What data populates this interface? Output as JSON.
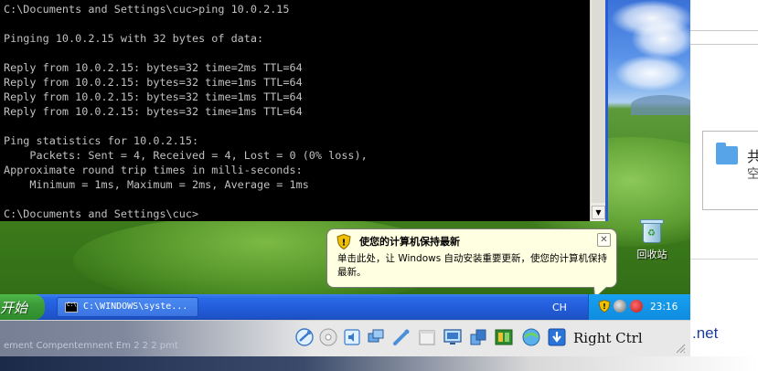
{
  "console": {
    "lines": [
      "C:\\Documents and Settings\\cuc>ping 10.0.2.15",
      "",
      "Pinging 10.0.2.15 with 32 bytes of data:",
      "",
      "Reply from 10.0.2.15: bytes=32 time=2ms TTL=64",
      "Reply from 10.0.2.15: bytes=32 time=1ms TTL=64",
      "Reply from 10.0.2.15: bytes=32 time=1ms TTL=64",
      "Reply from 10.0.2.15: bytes=32 time=1ms TTL=64",
      "",
      "Ping statistics for 10.0.2.15:",
      "    Packets: Sent = 4, Received = 4, Lost = 0 (0% loss),",
      "Approximate round trip times in milli-seconds:",
      "    Minimum = 1ms, Maximum = 2ms, Average = 1ms",
      "",
      "C:\\Documents and Settings\\cuc>"
    ],
    "scroll_down_icon": "triangle-down"
  },
  "desktop": {
    "recycle_bin_label": "回收站"
  },
  "balloon": {
    "title": "使您的计算机保持最新",
    "body": "单击此处，让 Windows 自动安装重要更新，使您的计算机保持最新。",
    "close_glyph": "✕"
  },
  "taskbar": {
    "start_label": "开始",
    "task_label": "C:\\WINDOWS\\syste...",
    "language": "CH",
    "clock": "23:16"
  },
  "vbox": {
    "host_key": "Right Ctrl",
    "background_text": "ement  Compentemnent  Em  2  2 2 pmt"
  },
  "host": {
    "panel_title": "共",
    "panel_sub": "空",
    "net_text": ".net"
  },
  "colors": {
    "console_bg": "#000000",
    "console_fg": "#c0c0c0",
    "balloon_bg": "#ffffe1",
    "taskbar_blue": "#245edb",
    "start_green": "#3c9c38",
    "tray_blue": "#0f8ce0"
  }
}
